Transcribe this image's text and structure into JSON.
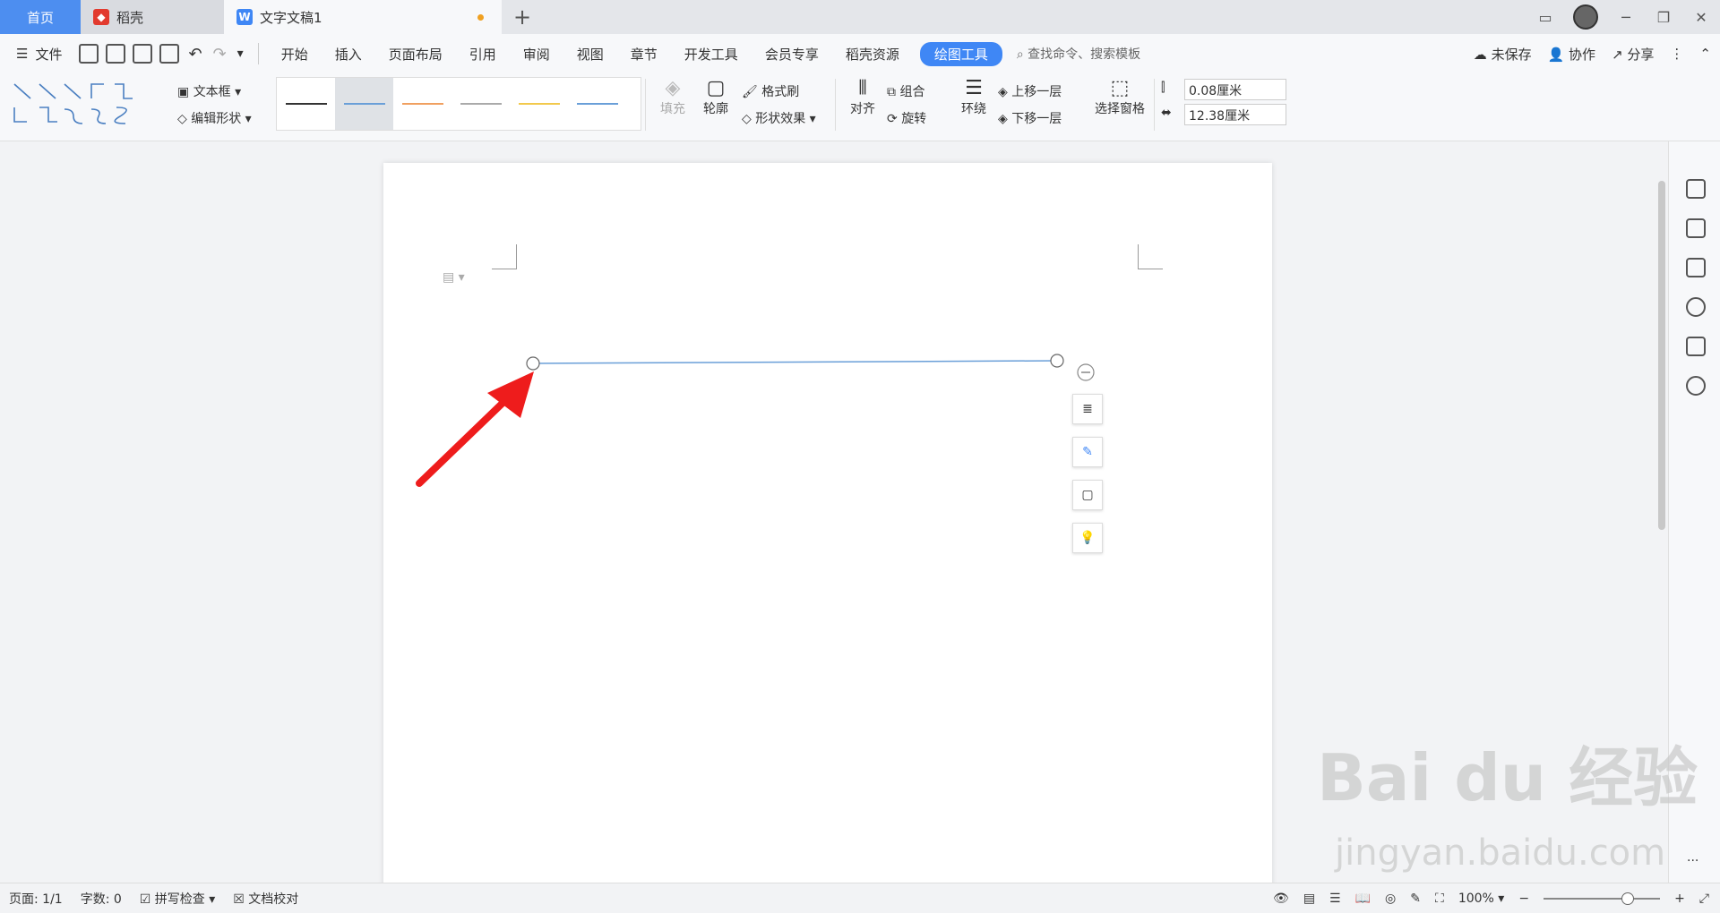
{
  "tabs": [
    {
      "label": "首页"
    },
    {
      "label": "稻壳"
    },
    {
      "label": "文字文稿1"
    }
  ],
  "menubar": {
    "file": "文件",
    "items": [
      "开始",
      "插入",
      "页面布局",
      "引用",
      "审阅",
      "视图",
      "章节",
      "开发工具",
      "会员专享",
      "稻壳资源"
    ],
    "active": "绘图工具",
    "search": "查找命令、搜索模板",
    "unsaved": "未保存",
    "collab": "协作",
    "share": "分享"
  },
  "ribbon": {
    "textbox": "文本框",
    "edit_shape": "编辑形状",
    "fill": "填充",
    "outline": "轮廓",
    "format_painter": "格式刷",
    "shape_effect": "形状效果",
    "align": "对齐",
    "group": "组合",
    "rotate": "旋转",
    "wrap": "环绕",
    "bring_forward": "上移一层",
    "send_backward": "下移一层",
    "selection_pane": "选择窗格",
    "height": "0.08厘米",
    "width": "12.38厘米"
  },
  "line_styles": [
    "#333333",
    "#6a9fd8",
    "#f0a060",
    "#aaaaaa",
    "#f2c94c",
    "#6a9fd8"
  ],
  "statusbar": {
    "page": "页面: 1/1",
    "words": "字数: 0",
    "spell": "拼写检查",
    "proof": "文档校对",
    "zoom": "100%",
    "zoom_level": 0.67
  },
  "watermark": {
    "logo": "Bai du 经验",
    "url": "jingyan.baidu.com"
  }
}
